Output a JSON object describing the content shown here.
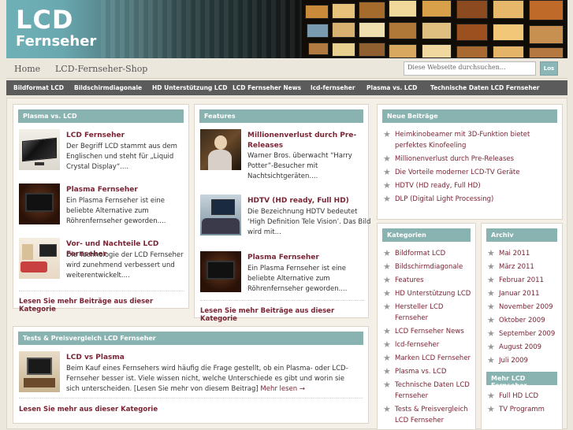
{
  "header": {
    "logo_line1": "LCD",
    "logo_line2": "Fernseher"
  },
  "nav": {
    "home": "Home",
    "shop": "LCD-Fernseher-Shop"
  },
  "search": {
    "placeholder": "Diese Webseite durchsuchen...",
    "button": "Los"
  },
  "categories_bar": [
    "Bildformat LCD",
    "Bildschirmdiagonale",
    "HD Unterstützung LCD",
    "LCD Fernseher News",
    "lcd-fernseher",
    "Plasma vs. LCD",
    "Technische Daten LCD Fernseher"
  ],
  "plasma_box": {
    "title": "Plasma vs. LCD",
    "posts": [
      {
        "title": "LCD Fernseher",
        "text": "Der Begriff LCD stammt aus dem Englischen und steht für „Liquid Crystal Display“...."
      },
      {
        "title": "Plasma Fernseher",
        "text": "Ein Plasma Fernseher ist eine beliebte Alternative zum Röhrenfernseher geworden...."
      },
      {
        "title": "Vor- und Nachteile LCD Fernseher",
        "text": "Die Technologie der LCD Fernseher wird zunehmend verbessert und weiterentwickelt...."
      }
    ],
    "more": "Lesen Sie mehr Beiträge aus dieser Kategorie"
  },
  "features_box": {
    "title": "Features",
    "posts": [
      {
        "title": "Millionenverlust durch Pre-Releases",
        "text": "Warner Bros. überwacht “Harry Potter”-Besucher mit Nachtsichtgeräten...."
      },
      {
        "title": "HDTV (HD ready, Full HD)",
        "text": "Die Bezeichnung HDTV bedeutet ‘High Definition Tele Vision’. Das Bild wird mit..."
      },
      {
        "title": "Plasma Fernseher",
        "text": "Ein Plasma Fernseher ist eine beliebte Alternative zum Röhrenfernseher geworden...."
      }
    ],
    "more": "Lesen Sie mehr Beiträge aus dieser Kategorie"
  },
  "tests_box": {
    "title": "Tests & Preisvergleich LCD Fernseher",
    "post_title": "LCD vs Plasma",
    "post_text": "Beim Kauf eines Fernsehers wird häufig die Frage gestellt, ob ein Plasma- oder LCD-Fernseher besser ist. Viele wissen nicht, welche Unterschiede es gibt und worin sie sich unterscheiden. [Lesen Sie mehr von diesem Beitrag]",
    "read_more": "Mehr lesen →",
    "more": "Lesen Sie mehr aus dieser Kategorie"
  },
  "recent_box": {
    "title": "Neue Beiträge",
    "items": [
      "Heimkinobeamer mit 3D-Funktion bietet perfektes Kinofeeling",
      "Millionenverlust durch Pre-Releases",
      "Die Vorteile moderner LCD-TV Geräte",
      "HDTV (HD ready, Full HD)",
      "DLP (Digital Light Processing)"
    ]
  },
  "kategorien_box": {
    "title": "Kategorien",
    "items": [
      "Bildformat LCD",
      "Bildschirmdiagonale",
      "Features",
      "HD Unterstützung LCD",
      "Hersteller LCD Fernseher",
      "LCD Fernseher News",
      "lcd-fernseher",
      "Marken LCD Fernseher",
      "Plasma vs. LCD",
      "Technische Daten LCD Fernseher",
      "Tests & Preisvergleich LCD Fernseher"
    ]
  },
  "archiv_box": {
    "title": "Archiv",
    "items": [
      "Mai 2011",
      "März 2011",
      "Februar 2011",
      "Januar 2011",
      "November 2009",
      "Oktober 2009",
      "September 2009",
      "August 2009",
      "Juli 2009"
    ]
  },
  "mehr_box": {
    "title": "Mehr LCD Fernseher",
    "items": [
      "Full HD LCD",
      "TV Programm"
    ]
  },
  "colors": {
    "accent": "#88b3b0",
    "link": "#7a2434",
    "catbar": "#5b5b5b"
  }
}
